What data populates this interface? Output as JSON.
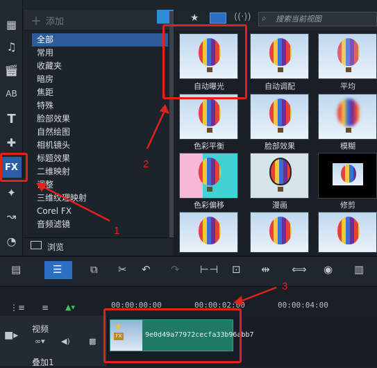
{
  "toolbar_top": {
    "add_label": "添加",
    "search_placeholder": "搜索当前视图"
  },
  "left_tools": [
    {
      "icon": "media-icon"
    },
    {
      "icon": "music-icon"
    },
    {
      "icon": "clapper-icon"
    },
    {
      "icon": "title-ab-icon"
    },
    {
      "icon": "text-t-icon"
    },
    {
      "icon": "puzzle-icon"
    },
    {
      "icon": "fx-icon",
      "label": "FX"
    },
    {
      "icon": "magic-wand-icon"
    },
    {
      "icon": "path-icon"
    },
    {
      "icon": "gauge-icon"
    }
  ],
  "categories": [
    "全部",
    "常用",
    "收藏夹",
    "暗房",
    "焦距",
    "特殊",
    "脸部效果",
    "自然绘图",
    "相机镜头",
    "标题效果",
    "二维映射",
    "调整",
    "三维纹理映射",
    "Corel FX",
    "音频滤镜"
  ],
  "browse_label": "浏览",
  "thumbnails": [
    "自动曝光",
    "自动调配",
    "平均",
    "色彩平衡",
    "脸部效果",
    "模糊",
    "色彩偏移",
    "漫画",
    "修剪",
    "",
    "",
    " "
  ],
  "timeline": {
    "times": [
      "00:00:00:00",
      "00:00:02:00",
      "00:00:04:00"
    ],
    "video_label": "视频",
    "overlay_label": "叠加1",
    "clip_name": "9e0d49a77972cecfa33b96abb7"
  },
  "annotations": [
    "1",
    "2",
    "3"
  ],
  "colors": {
    "accent": "#2d5c9a",
    "annotation": "#e3211c",
    "clip": "#1f7a64"
  }
}
